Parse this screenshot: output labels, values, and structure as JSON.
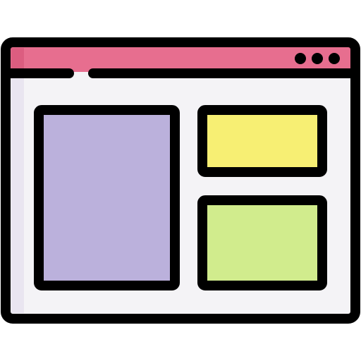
{
  "icon": {
    "name": "browser-window-layout-icon",
    "colors": {
      "outline": "#000000",
      "title_bar": "#e76e8f",
      "title_bar_shade": "#dc5d80",
      "window_body": "#f4f3f6",
      "window_body_shade": "#e9e5f0",
      "main_panel": "#bbb1dc",
      "top_right_panel": "#f7ef73",
      "bottom_right_panel": "#d1ec8d"
    },
    "window_control_dots": 3
  }
}
